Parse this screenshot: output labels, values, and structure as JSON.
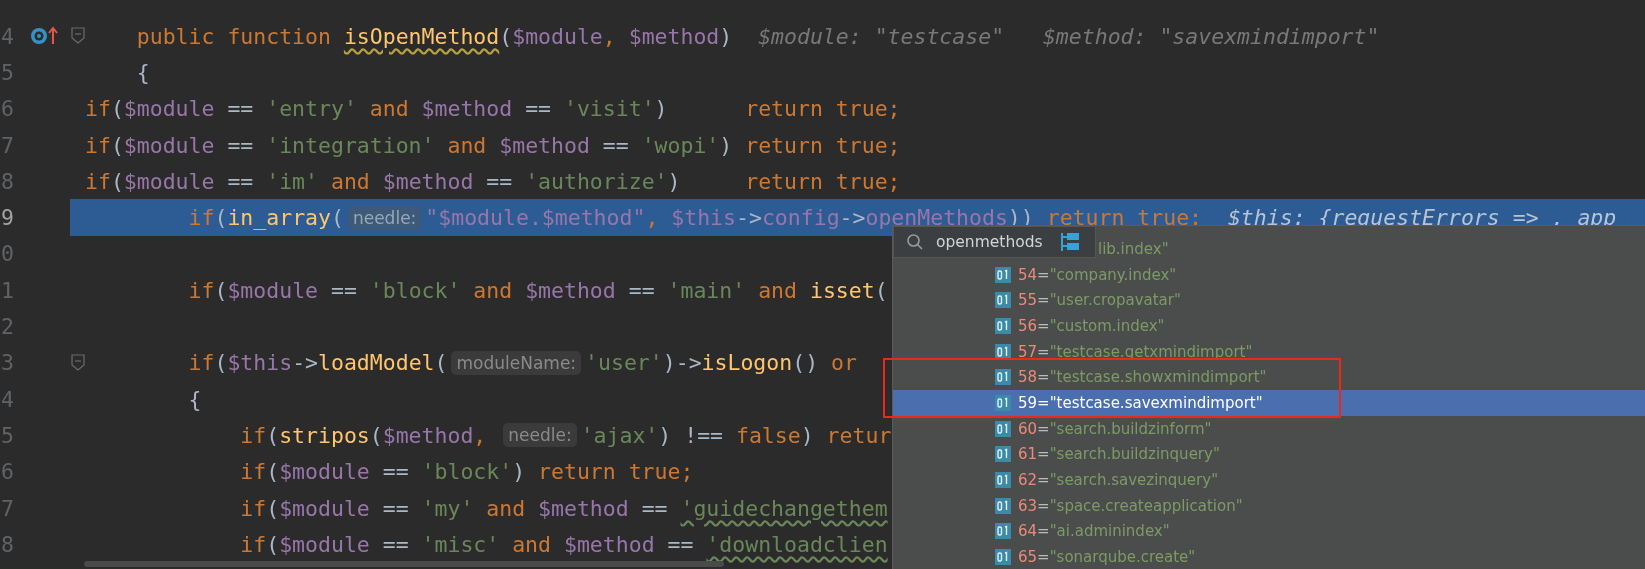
{
  "editor": {
    "lines": [
      {
        "number": "4",
        "kind": "method",
        "fold": true,
        "selected": false,
        "tokens": [
          {
            "kind": "kw",
            "text": "    public function "
          },
          {
            "kind": "fn-typo",
            "text": "isOpenMethod"
          },
          {
            "kind": "txt",
            "text": "("
          },
          {
            "kind": "var",
            "text": "$module"
          },
          {
            "kind": "kw",
            "text": ", "
          },
          {
            "kind": "var",
            "text": "$method"
          },
          {
            "kind": "txt",
            "text": ")"
          },
          {
            "kind": "debug",
            "text": "  $module: \"testcase\"   $method: \"savexmindimport\""
          }
        ]
      },
      {
        "number": "5",
        "kind": "code",
        "fold": false,
        "selected": false,
        "tokens": [
          {
            "kind": "txt",
            "text": "    {"
          }
        ]
      },
      {
        "number": "6",
        "kind": "code",
        "fold": false,
        "selected": false,
        "tokens": [
          {
            "kind": "kw",
            "text": "if"
          },
          {
            "kind": "txt",
            "text": "("
          },
          {
            "kind": "var",
            "text": "$module"
          },
          {
            "kind": "txt",
            "text": " == "
          },
          {
            "kind": "str",
            "text": "'entry'"
          },
          {
            "kind": "kw",
            "text": " and "
          },
          {
            "kind": "var",
            "text": "$method"
          },
          {
            "kind": "txt",
            "text": " == "
          },
          {
            "kind": "str",
            "text": "'visit'"
          },
          {
            "kind": "txt",
            "text": ")      "
          },
          {
            "kind": "kw",
            "text": "return true;"
          }
        ]
      },
      {
        "number": "7",
        "kind": "code",
        "fold": false,
        "selected": false,
        "tokens": [
          {
            "kind": "kw",
            "text": "if"
          },
          {
            "kind": "txt",
            "text": "("
          },
          {
            "kind": "var",
            "text": "$module"
          },
          {
            "kind": "txt",
            "text": " == "
          },
          {
            "kind": "str",
            "text": "'integration'"
          },
          {
            "kind": "kw",
            "text": " and "
          },
          {
            "kind": "var",
            "text": "$method"
          },
          {
            "kind": "txt",
            "text": " == "
          },
          {
            "kind": "str",
            "text": "'wopi'"
          },
          {
            "kind": "txt",
            "text": ") "
          },
          {
            "kind": "kw",
            "text": "return true;"
          }
        ]
      },
      {
        "number": "8",
        "kind": "code",
        "fold": false,
        "selected": false,
        "tokens": [
          {
            "kind": "kw",
            "text": "if"
          },
          {
            "kind": "txt",
            "text": "("
          },
          {
            "kind": "var",
            "text": "$module"
          },
          {
            "kind": "txt",
            "text": " == "
          },
          {
            "kind": "str",
            "text": "'im'"
          },
          {
            "kind": "kw",
            "text": " and "
          },
          {
            "kind": "var",
            "text": "$method"
          },
          {
            "kind": "txt",
            "text": " == "
          },
          {
            "kind": "str",
            "text": "'authorize'"
          },
          {
            "kind": "txt",
            "text": ")     "
          },
          {
            "kind": "kw",
            "text": "return true;"
          }
        ]
      },
      {
        "number": "9",
        "kind": "code",
        "fold": false,
        "selected": true,
        "tokens": [
          {
            "kind": "kw",
            "text": "        if"
          },
          {
            "kind": "txt",
            "text": "("
          },
          {
            "kind": "fn",
            "text": "in_array"
          },
          {
            "kind": "txt",
            "text": "("
          },
          {
            "kind": "hint",
            "text": "needle:"
          },
          {
            "kind": "var",
            "text": "\"$module.$method\""
          },
          {
            "kind": "kw",
            "text": ", "
          },
          {
            "kind": "var",
            "text": "$this"
          },
          {
            "kind": "txt",
            "text": "->"
          },
          {
            "kind": "var",
            "text": "config"
          },
          {
            "kind": "txt",
            "text": "->"
          },
          {
            "kind": "var",
            "text": "openMethods"
          },
          {
            "kind": "txt",
            "text": "))"
          },
          {
            "kind": "kw",
            "text": " return true;"
          },
          {
            "kind": "debug",
            "text": "  $this: {requestErrors => , app"
          }
        ]
      },
      {
        "number": "0",
        "kind": "code",
        "fold": false,
        "selected": false
      },
      {
        "number": "1",
        "kind": "code",
        "fold": false,
        "selected": false,
        "tokens": [
          {
            "kind": "kw",
            "text": "        if"
          },
          {
            "kind": "txt",
            "text": "("
          },
          {
            "kind": "var",
            "text": "$module"
          },
          {
            "kind": "txt",
            "text": " == "
          },
          {
            "kind": "str",
            "text": "'block'"
          },
          {
            "kind": "kw",
            "text": " and "
          },
          {
            "kind": "var",
            "text": "$method"
          },
          {
            "kind": "txt",
            "text": " == "
          },
          {
            "kind": "str",
            "text": "'main'"
          },
          {
            "kind": "kw",
            "text": " and "
          },
          {
            "kind": "fn",
            "text": "isset"
          },
          {
            "kind": "txt",
            "text": "("
          }
        ]
      },
      {
        "number": "2",
        "kind": "code",
        "fold": false,
        "selected": false
      },
      {
        "number": "3",
        "kind": "code",
        "fold": true,
        "selected": false,
        "tokens": [
          {
            "kind": "kw",
            "text": "        if"
          },
          {
            "kind": "txt",
            "text": "("
          },
          {
            "kind": "var",
            "text": "$this"
          },
          {
            "kind": "txt",
            "text": "->"
          },
          {
            "kind": "fn",
            "text": "loadModel"
          },
          {
            "kind": "txt",
            "text": "("
          },
          {
            "kind": "hint",
            "text": "moduleName:"
          },
          {
            "kind": "str",
            "text": "'user'"
          },
          {
            "kind": "txt",
            "text": ")->"
          },
          {
            "kind": "fn",
            "text": "isLogon"
          },
          {
            "kind": "txt",
            "text": "() "
          },
          {
            "kind": "kw",
            "text": "or"
          }
        ]
      },
      {
        "number": "4",
        "kind": "code",
        "fold": false,
        "selected": false,
        "tokens": [
          {
            "kind": "txt",
            "text": "        {"
          }
        ]
      },
      {
        "number": "5",
        "kind": "code",
        "fold": false,
        "selected": false,
        "tokens": [
          {
            "kind": "kw",
            "text": "            if"
          },
          {
            "kind": "txt",
            "text": "("
          },
          {
            "kind": "fn",
            "text": "stripos"
          },
          {
            "kind": "txt",
            "text": "("
          },
          {
            "kind": "var",
            "text": "$method"
          },
          {
            "kind": "kw",
            "text": ", "
          },
          {
            "kind": "hint",
            "text": "needle:"
          },
          {
            "kind": "str",
            "text": "'ajax'"
          },
          {
            "kind": "txt",
            "text": ") !== "
          },
          {
            "kind": "kw",
            "text": "false"
          },
          {
            "kind": "txt",
            "text": ") "
          },
          {
            "kind": "kw",
            "text": "retur"
          }
        ]
      },
      {
        "number": "6",
        "kind": "code",
        "fold": false,
        "selected": false,
        "tokens": [
          {
            "kind": "kw",
            "text": "            if"
          },
          {
            "kind": "txt",
            "text": "("
          },
          {
            "kind": "var",
            "text": "$module"
          },
          {
            "kind": "txt",
            "text": " == "
          },
          {
            "kind": "str",
            "text": "'block'"
          },
          {
            "kind": "txt",
            "text": ") "
          },
          {
            "kind": "kw",
            "text": "return true;"
          }
        ]
      },
      {
        "number": "7",
        "kind": "code",
        "fold": false,
        "selected": false,
        "tokens": [
          {
            "kind": "kw",
            "text": "            if"
          },
          {
            "kind": "txt",
            "text": "("
          },
          {
            "kind": "var",
            "text": "$module"
          },
          {
            "kind": "txt",
            "text": " == "
          },
          {
            "kind": "str",
            "text": "'my'"
          },
          {
            "kind": "kw",
            "text": " and "
          },
          {
            "kind": "var",
            "text": "$method"
          },
          {
            "kind": "txt",
            "text": " == "
          },
          {
            "kind": "str-typo",
            "text": "'guidechangethem"
          }
        ]
      },
      {
        "number": "8",
        "kind": "code",
        "fold": false,
        "selected": false,
        "tokens": [
          {
            "kind": "kw",
            "text": "            if"
          },
          {
            "kind": "txt",
            "text": "("
          },
          {
            "kind": "var",
            "text": "$module"
          },
          {
            "kind": "txt",
            "text": " == "
          },
          {
            "kind": "str",
            "text": "'misc'"
          },
          {
            "kind": "kw",
            "text": " and "
          },
          {
            "kind": "var",
            "text": "$method"
          },
          {
            "kind": "txt",
            "text": " == "
          },
          {
            "kind": "str-typo",
            "text": "'downloadclien"
          }
        ]
      }
    ]
  },
  "popup": {
    "search": {
      "value": "openmethods"
    },
    "top_row_text": "lib.index\"",
    "items": [
      {
        "index": "54",
        "sign": "=",
        "value": "\"company.index\"",
        "selected": false
      },
      {
        "index": "55",
        "sign": "=",
        "value": "\"user.cropavatar\"",
        "selected": false
      },
      {
        "index": "56",
        "sign": "=",
        "value": "\"custom.index\"",
        "selected": false
      },
      {
        "index": "57",
        "sign": "=",
        "value": "\"testcase.getxmindimport\"",
        "selected": false
      },
      {
        "index": "58",
        "sign": "=",
        "value": "\"testcase.showxmindimport\"",
        "selected": false
      },
      {
        "index": "59",
        "sign": "=",
        "value": "\"testcase.savexmindimport\"",
        "selected": true
      },
      {
        "index": "60",
        "sign": "=",
        "value": "\"search.buildzinform\"",
        "selected": false
      },
      {
        "index": "61",
        "sign": "=",
        "value": "\"search.buildzinquery\"",
        "selected": false
      },
      {
        "index": "62",
        "sign": "=",
        "value": "\"search.savezinquery\"",
        "selected": false
      },
      {
        "index": "63",
        "sign": "=",
        "value": "\"space.createapplication\"",
        "selected": false
      },
      {
        "index": "64",
        "sign": "=",
        "value": "\"ai.adminindex\"",
        "selected": false
      },
      {
        "index": "65",
        "sign": "=",
        "value": "\"sonarqube.create\"",
        "selected": false
      }
    ]
  }
}
